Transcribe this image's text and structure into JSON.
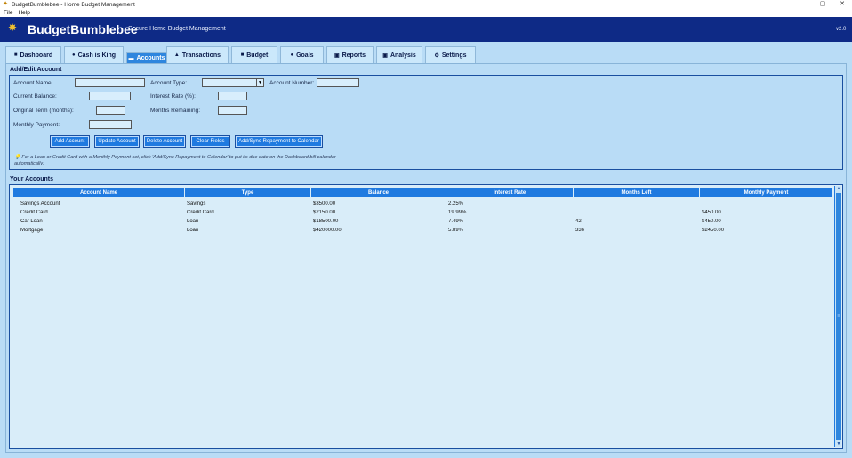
{
  "window": {
    "title": "BudgetBumblebee - Home Budget Management"
  },
  "menu": [
    "File",
    "Help"
  ],
  "header": {
    "brand": "BudgetBumblebee",
    "tagline": "Secure Home Budget Management",
    "version": "v2.0"
  },
  "tabs": [
    {
      "label": "Dashboard",
      "icon": "dashboard-icon"
    },
    {
      "label": "Cash is King",
      "icon": "cash-icon"
    },
    {
      "label": "Accounts",
      "icon": "accounts-icon",
      "active": true
    },
    {
      "label": "Transactions",
      "icon": "transactions-icon"
    },
    {
      "label": "Budget",
      "icon": "budget-icon"
    },
    {
      "label": "Goals",
      "icon": "goals-icon"
    },
    {
      "label": "Reports",
      "icon": "reports-icon"
    },
    {
      "label": "Analysis",
      "icon": "analysis-icon"
    },
    {
      "label": "Settings",
      "icon": "settings-icon"
    }
  ],
  "form": {
    "title": "Add/Edit Account",
    "labels": {
      "account_name": "Account Name:",
      "account_type": "Account Type:",
      "account_number": "Account Number:",
      "current_balance": "Current Balance:",
      "interest_rate": "Interest Rate (%):",
      "original_term": "Original Term (months):",
      "months_remaining": "Months Remaining:",
      "monthly_payment": "Monthly Payment:"
    },
    "values": {
      "account_name": "",
      "account_type": "",
      "account_number": "",
      "current_balance": "",
      "interest_rate": "",
      "original_term": "",
      "months_remaining": "",
      "monthly_payment": ""
    },
    "buttons": {
      "add": "Add Account",
      "update": "Update Account",
      "delete": "Delete Account",
      "clear": "Clear Fields",
      "sync": "Add/Sync Repayment to Calendar"
    },
    "hint": "💡 For a Loan or Credit Card with a Monthly Payment set, click 'Add/Sync Repayment to Calendar' to put its due date on the Dashboard bill calendar automatically."
  },
  "accounts": {
    "title": "Your Accounts",
    "columns": [
      "Account Name",
      "Type",
      "Balance",
      "Interest Rate",
      "Months Left",
      "Monthly Payment"
    ],
    "rows": [
      [
        "Savings Account",
        "Savings",
        "$3500.00",
        "2.25%",
        "",
        ""
      ],
      [
        "Credit Card",
        "Credit Card",
        "$2150.00",
        "19.99%",
        "",
        "$450.00"
      ],
      [
        "Car Loan",
        "Loan",
        "$18500.00",
        "7.49%",
        "42",
        "$450.00"
      ],
      [
        "Mortgage",
        "Loan",
        "$420000.00",
        "5.89%",
        "336",
        "$2450.00"
      ]
    ]
  },
  "colors": {
    "header": "#0e2a86",
    "accent": "#1f7ae0",
    "background": "#b9dcf6"
  }
}
